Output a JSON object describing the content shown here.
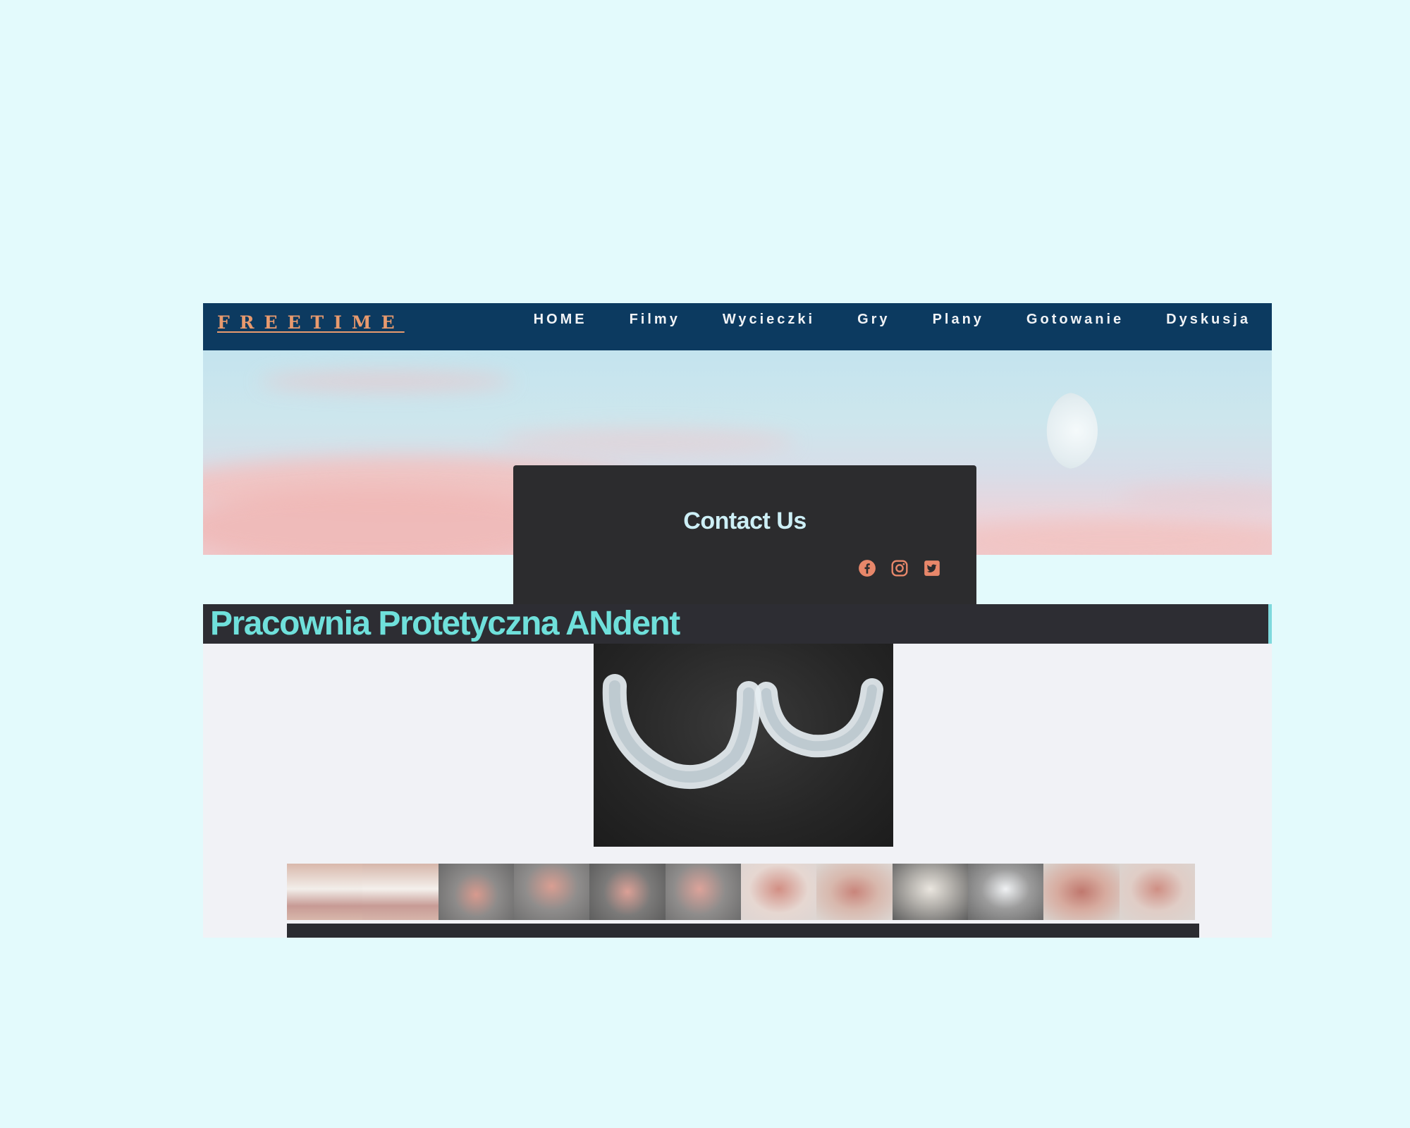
{
  "nav": {
    "brand": "FREETIME",
    "links": [
      "HOME",
      "Filmy",
      "Wycieczki",
      "Gry",
      "Plany",
      "Gotowanie",
      "Dyskusja"
    ]
  },
  "contact": {
    "title": "Contact Us",
    "social": [
      "facebook-icon",
      "instagram-icon",
      "twitter-icon"
    ]
  },
  "site_title": "Pracownia Protetyczna ANdent",
  "gallery": {
    "thumb_count": 12
  },
  "colors": {
    "page_bg": "#e3fafc",
    "nav_bg": "#0c3a60",
    "brand": "#e89a6e",
    "contact_bg": "#2c2c2e",
    "title_text": "#6fe0db",
    "social_icon": "#e8876a"
  }
}
